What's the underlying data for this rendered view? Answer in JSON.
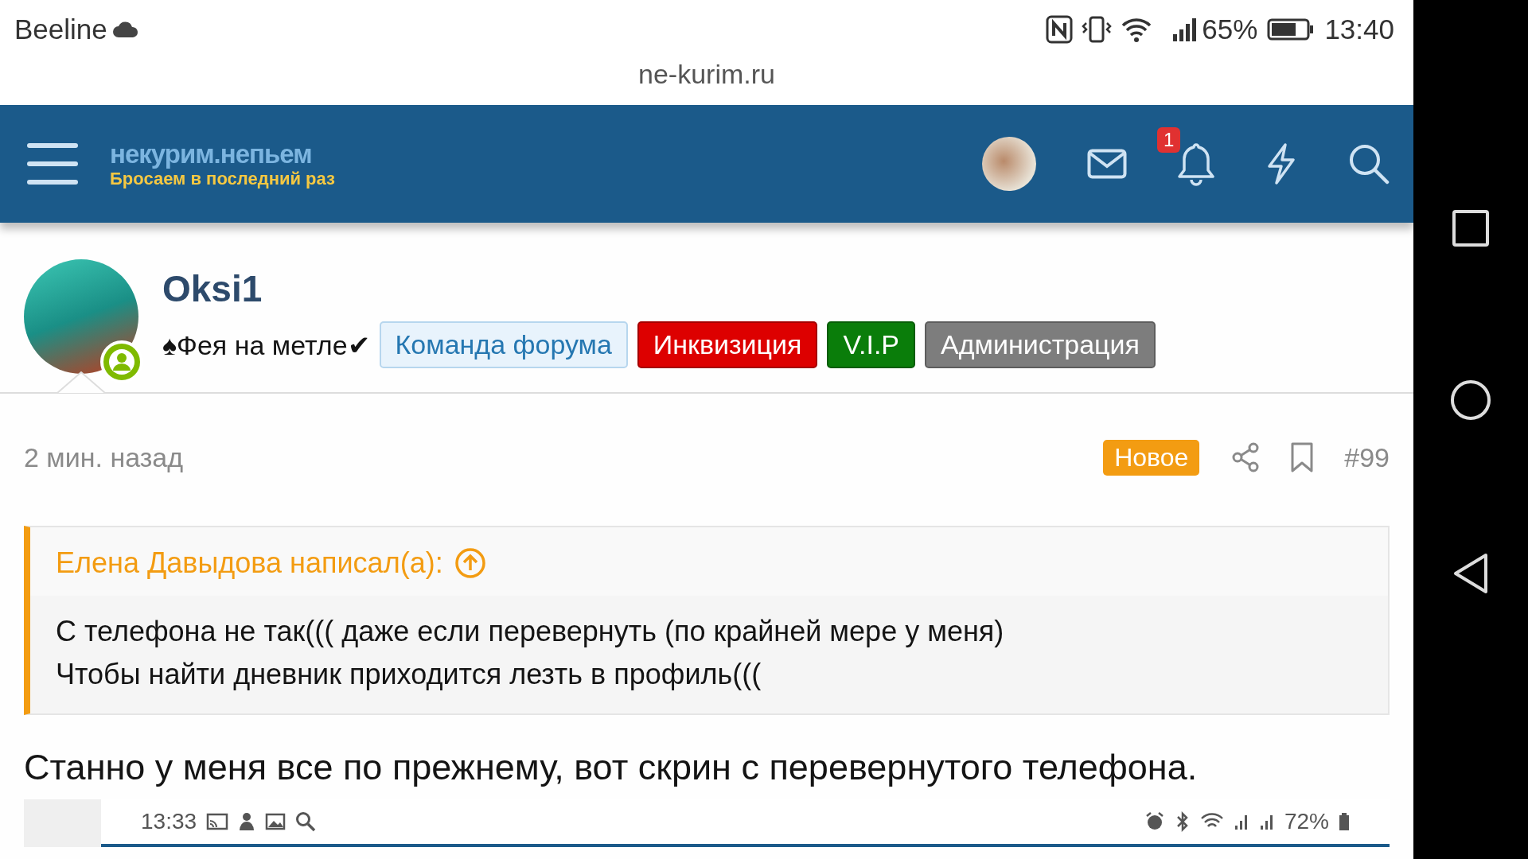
{
  "status_bar": {
    "carrier": "Beeline",
    "battery": "65%",
    "time": "13:40"
  },
  "address_bar": {
    "url": "ne-kurim.ru"
  },
  "header": {
    "logo_title": "некурим.непьем",
    "logo_subtitle": "Бросаем в последний раз",
    "notification_count": "1"
  },
  "post": {
    "author": "Oksi1",
    "online": true,
    "user_title": "♠Фея на метле✔",
    "banners": [
      {
        "label": "Команда форума",
        "color": "#e8f3fc"
      },
      {
        "label": "Инквизиция",
        "color": "#dd0000"
      },
      {
        "label": "V.I.P",
        "color": "#0a7d0a"
      },
      {
        "label": "Администрация",
        "color": "#7d7d7d"
      }
    ],
    "time": "2 мин. назад",
    "new_label": "Новое",
    "number": "#99",
    "quote": {
      "attribution": "Елена Давыдова написал(а):",
      "lines": [
        "С телефона не так((( даже если перевернуть (по крайней мере у меня)",
        "Чтобы найти дневник приходится лезть в профиль((("
      ]
    },
    "text": "Станно у меня все по прежнему, вот скрин с перевернутого телефона.",
    "embedded_screenshot": {
      "time": "13:33",
      "battery": "72%"
    }
  }
}
